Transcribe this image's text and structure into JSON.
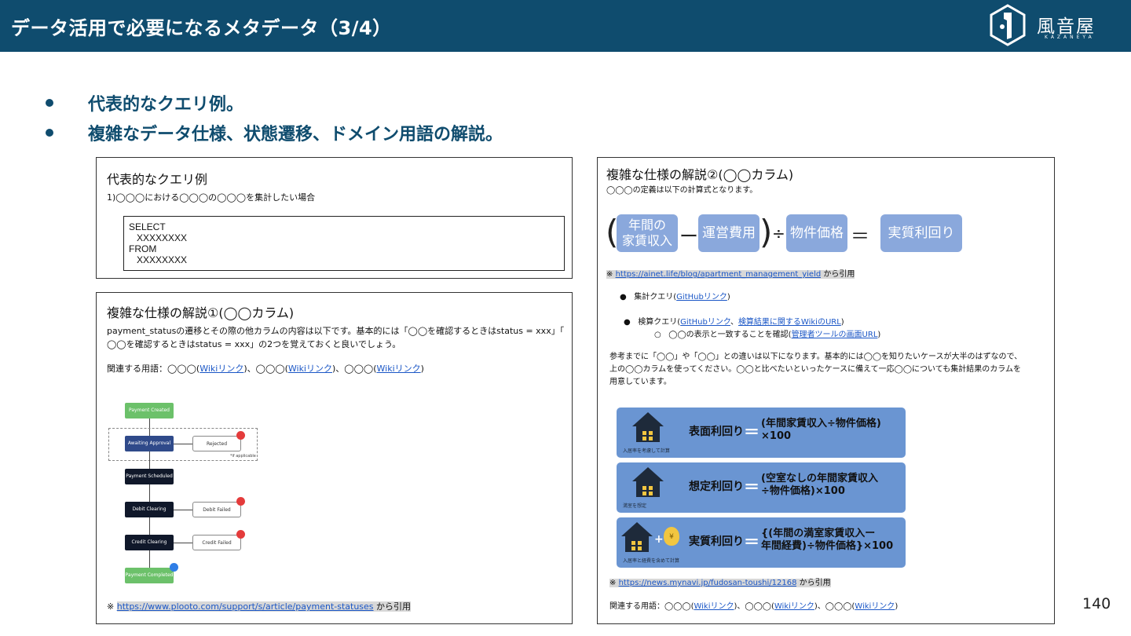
{
  "header": {
    "title": "データ活用で必要になるメタデータ（3/4）",
    "logo_text": "風音屋",
    "logo_sub": "KAZANEYA"
  },
  "bullets": [
    "代表的なクエリ例。",
    "複雑なデータ仕様、状態遷移、ドメイン用語の解説。"
  ],
  "query_panel": {
    "title": "代表的なクエリ例",
    "subtitle": "1)◯◯◯における◯◯◯の◯◯◯を集計したい場合",
    "sql_lines": [
      "SELECT",
      "   XXXXXXXX",
      "FROM",
      "   XXXXXXXX"
    ]
  },
  "spec1_panel": {
    "title": "複雑な仕様の解説①(◯◯カラム)",
    "desc_line1": "payment_statusの遷移とその際の他カラムの内容は以下です。基本的には「◯◯を確認するときはstatus = xxx」「",
    "desc_line2": "◯◯を確認するときはstatus = xxx」の2つを覚えておくと良いでしょう。",
    "terms_label": "関連する用語：◯◯◯(",
    "terms_sep": ")、◯◯◯(",
    "terms_end": ")",
    "wiki_link": "Wikiリンク",
    "flow": {
      "payment_created": "Payment Created",
      "awaiting_approval": "Awaiting Approval",
      "rejected": "Rejected",
      "if_applicable": "*if applicable",
      "payment_scheduled": "Payment Scheduled",
      "debit_clearing": "Debit Clearing",
      "debit_failed": "Debit Failed",
      "credit_clearing": "Credit Clearing",
      "credit_failed": "Credit Failed",
      "payment_completed": "Payment Completed"
    },
    "source_prefix": "※ ",
    "source_url": "https://www.plooto.com/support/s/article/payment-statuses",
    "source_suffix": " から引用"
  },
  "spec2_panel": {
    "title": "複雑な仕様の解説②(◯◯カラム)",
    "subtitle": "◯◯◯の定義は以下の計算式となります。",
    "formula": {
      "box1_line1": "年間の",
      "box1_line2": "家賃収入",
      "minus": "ー",
      "box2": "運営費用",
      "divide": "÷",
      "box3": "物件価格",
      "equals": "＝",
      "box4": "実質利回り",
      "open_paren": "(",
      "close_paren": ")"
    },
    "source1_prefix": "※ ",
    "source1_url": "https://ainet.life/blog/apartment_management_yield",
    "source1_suffix": " から引用",
    "agg_query_label": "集計クエリ(",
    "github_link": "GitHubリンク",
    "agg_query_end": ")",
    "search_query_label": "検算クエリ(",
    "search_sep": "、",
    "search_result_link": "検算結果に関するWikiのURL",
    "search_end": ")",
    "sub_bullet_label": "◯◯の表示と一致することを確認(",
    "admin_link": "管理者ツールの画面URL",
    "sub_bullet_end": ")",
    "note_line1": "参考までに「◯◯」や「◯◯」との違いは以下になります。基本的には◯◯を知りたいケースが大半のはずなので、",
    "note_line2": "上の◯◯カラムを使ってください。◯◯と比べたいといったケースに備えて一応◯◯についても集計結果のカラムを",
    "note_line3": "用意しています。",
    "cards": [
      {
        "title": "表面利回り",
        "eq": "＝",
        "line1": "(年間家賃収入÷物件価格)",
        "line2": "×100",
        "caption": "入居率を考慮して計算"
      },
      {
        "title": "想定利回り",
        "eq": "＝",
        "line1": "(空室なしの年間家賃収入",
        "line2": "÷物件価格)×100",
        "caption": "満室を想定"
      },
      {
        "title": "実質利回り",
        "eq": "＝",
        "line1": "{(年間の満室家賃収入ー",
        "line2": "年間経費)÷物件価格}×100",
        "caption": "入居率と経費を含めて計算"
      }
    ],
    "yen_symbol": "¥",
    "plus_symbol": "+",
    "source2_prefix": "※ ",
    "source2_url": "https://news.mynavi.jp/fudosan-toushi/12168",
    "source2_suffix": " から引用",
    "terms_label": "関連する用語：◯◯◯(",
    "terms_sep": ")、◯◯◯(",
    "terms_end": ")",
    "wiki_link": "Wikiリンク"
  },
  "page_number": "140",
  "colors": {
    "header_bg": "#0f4c6e",
    "accent_text": "#0f4c6e",
    "link": "#1a56c6",
    "formula_box": "#8aa8dc",
    "card_bg": "#6a95d2"
  }
}
